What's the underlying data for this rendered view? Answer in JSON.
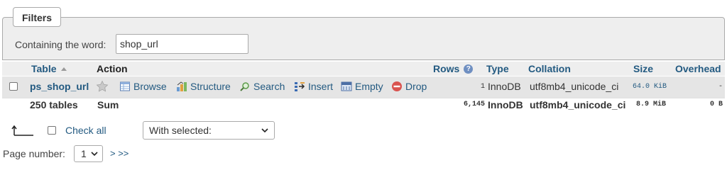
{
  "filters": {
    "legend": "Filters",
    "label": "Containing the word:",
    "value": "shop_url"
  },
  "table": {
    "headers": {
      "table": "Table",
      "action": "Action",
      "rows": "Rows",
      "type": "Type",
      "collation": "Collation",
      "size": "Size",
      "overhead": "Overhead"
    },
    "row": {
      "name": "ps_shop_url",
      "actions": {
        "browse": "Browse",
        "structure": "Structure",
        "search": "Search",
        "insert": "Insert",
        "empty": "Empty",
        "drop": "Drop"
      },
      "rows": "1",
      "type": "InnoDB",
      "collation": "utf8mb4_unicode_ci",
      "size": "64.0 KiB",
      "overhead": "-"
    },
    "footer": {
      "tables": "250 tables",
      "sum": "Sum",
      "rows": "6,145",
      "type": "InnoDB",
      "collation": "utf8mb4_unicode_ci",
      "size": "8.9 MiB",
      "overhead": "0 B"
    }
  },
  "bulk": {
    "check_all": "Check all",
    "with_selected": "With selected:"
  },
  "pagination": {
    "label": "Page number:",
    "value": "1",
    "next": "> >>"
  },
  "colors": {
    "link": "#235a81",
    "header_bg": "#eeeeee",
    "row_bg": "#e5e5e5",
    "drop_icon": "#d9534f"
  }
}
